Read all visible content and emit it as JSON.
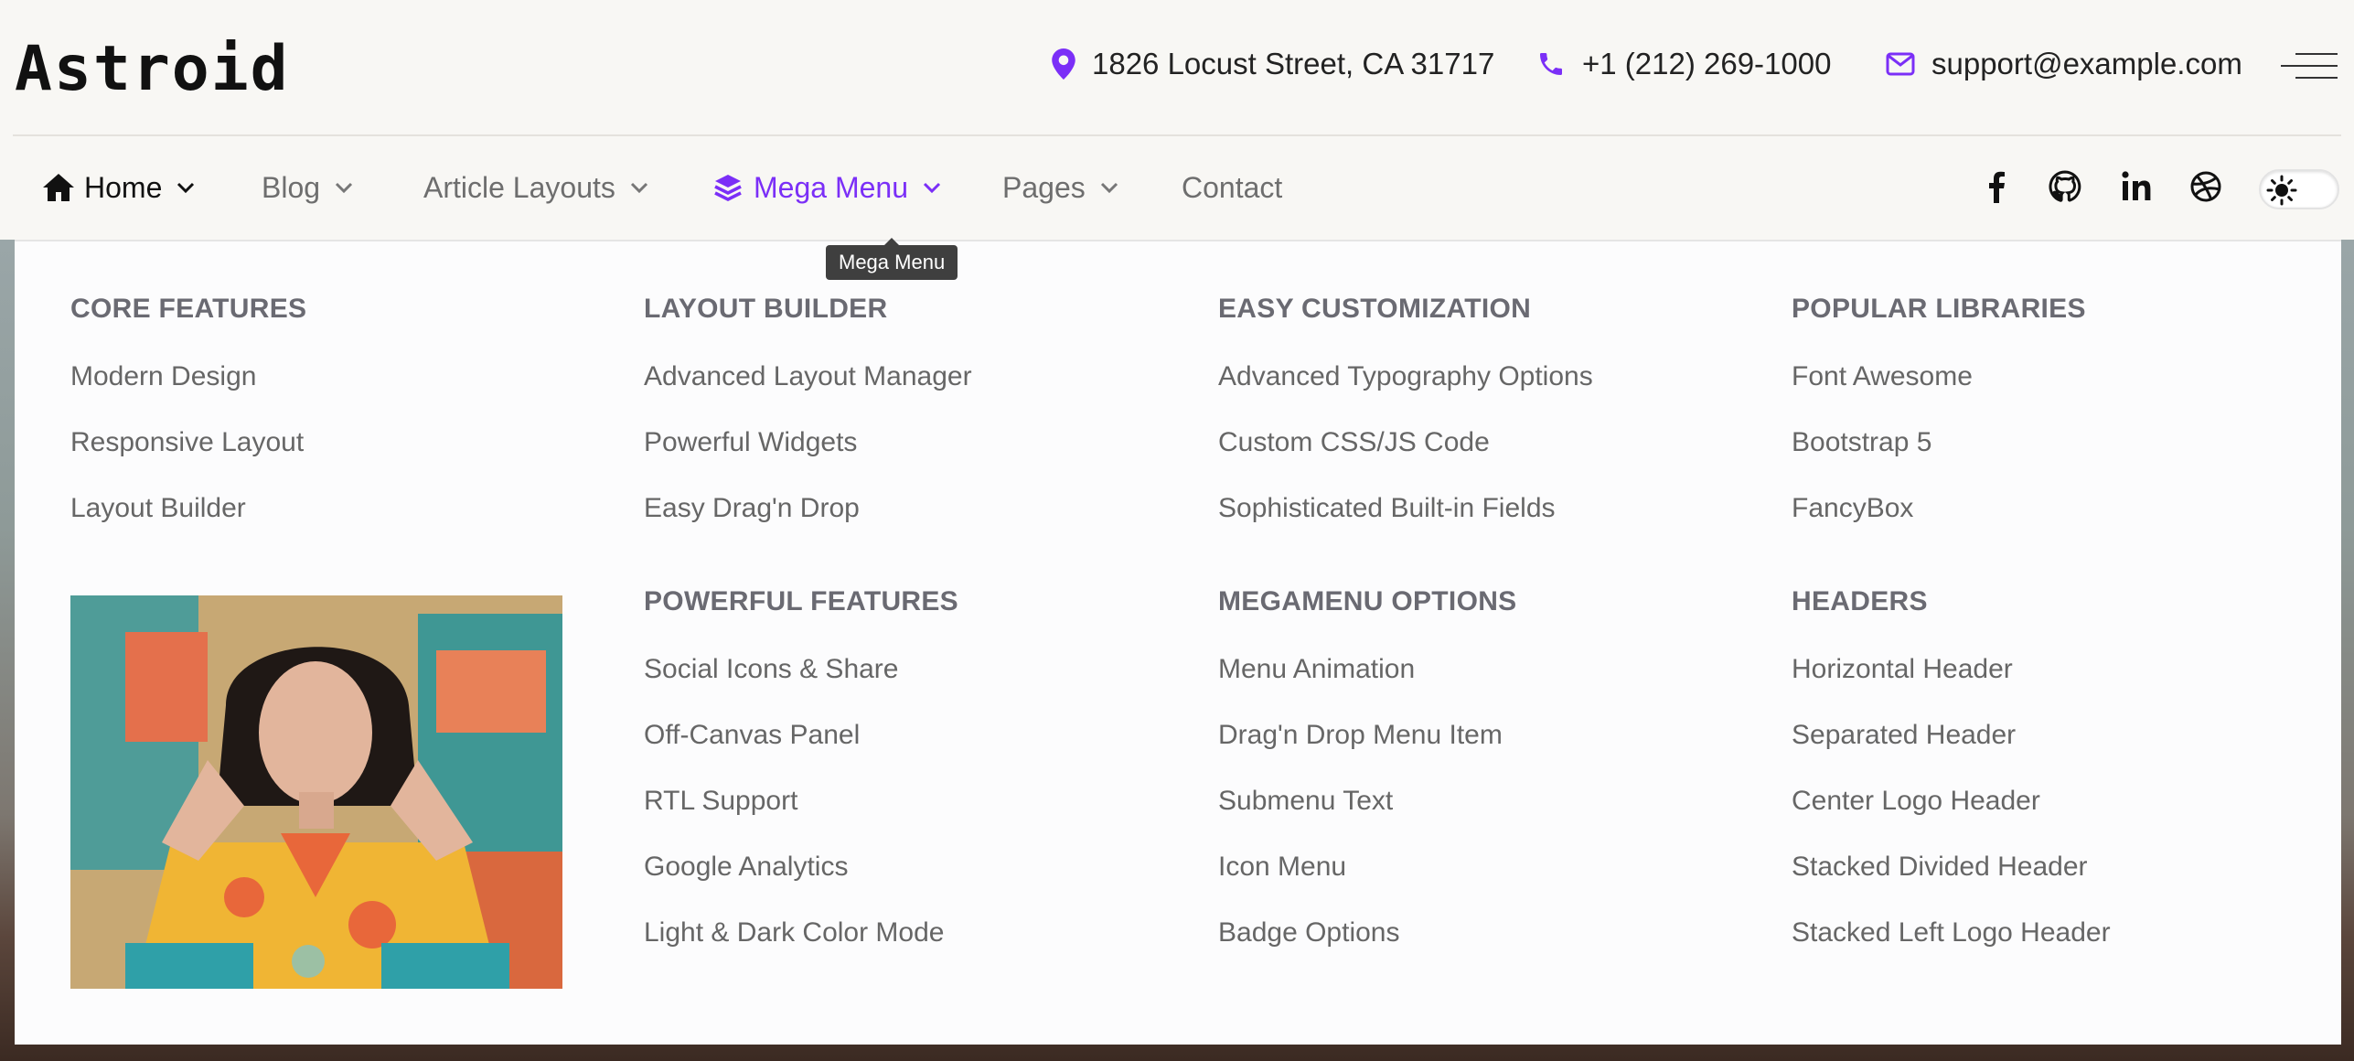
{
  "brand": {
    "logo_text": "Astroid"
  },
  "contact": {
    "address": "1826 Locust Street, CA 31717",
    "phone": "+1 (212) 269-1000",
    "email": "support@example.com"
  },
  "nav": {
    "items": [
      {
        "label": "Home"
      },
      {
        "label": "Blog"
      },
      {
        "label": "Article Layouts"
      },
      {
        "label": "Mega Menu"
      },
      {
        "label": "Pages"
      },
      {
        "label": "Contact"
      }
    ],
    "tooltip": "Mega Menu"
  },
  "social": [
    "facebook-icon",
    "github-icon",
    "linkedin-icon",
    "dribbble-icon"
  ],
  "colors": {
    "accent": "#7b2ff7",
    "text": "#222222",
    "muted": "#6e6e6e"
  },
  "mega": {
    "columns": [
      {
        "title": "CORE FEATURES",
        "items": [
          "Modern Design",
          "Responsive Layout",
          "Layout Builder"
        ]
      },
      {
        "title": "LAYOUT BUILDER",
        "items": [
          "Advanced Layout Manager",
          "Powerful Widgets",
          "Easy Drag'n Drop"
        ]
      },
      {
        "title": "EASY CUSTOMIZATION",
        "items": [
          "Advanced Typography Options",
          "Custom CSS/JS Code",
          "Sophisticated Built-in Fields"
        ]
      },
      {
        "title": "POPULAR LIBRARIES",
        "items": [
          "Font Awesome",
          "Bootstrap 5",
          "FancyBox"
        ]
      },
      {
        "title": "POWERFUL FEATURES",
        "items": [
          "Social Icons & Share",
          "Off-Canvas Panel",
          "RTL Support",
          "Google Analytics",
          "Light & Dark Color Mode"
        ]
      },
      {
        "title": "MEGAMENU OPTIONS",
        "items": [
          "Menu Animation",
          "Drag'n Drop Menu Item",
          "Submenu Text",
          "Icon Menu",
          "Badge Options"
        ]
      },
      {
        "title": "HEADERS",
        "items": [
          "Horizontal Header",
          "Separated Header",
          "Center Logo Header",
          "Stacked Divided Header",
          "Stacked Left Logo Header"
        ]
      }
    ]
  }
}
